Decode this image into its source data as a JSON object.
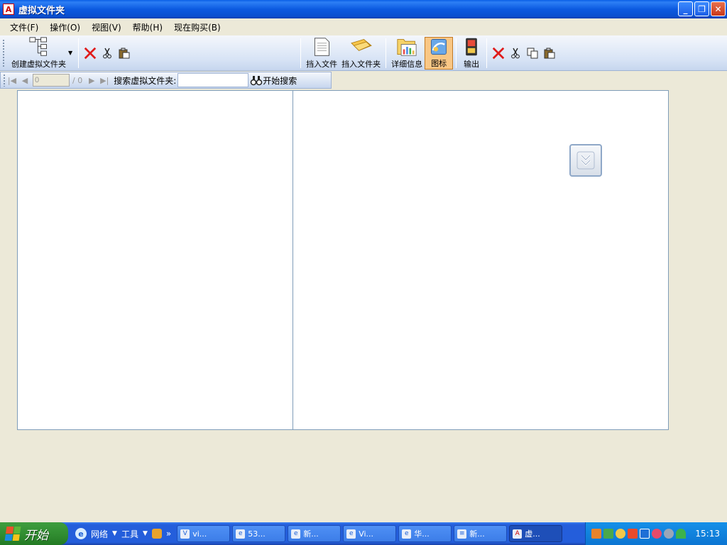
{
  "window": {
    "title": "虚拟文件夹",
    "app_icon": "A",
    "controls": {
      "minimize": "_",
      "restore": "❐",
      "close": "✕"
    }
  },
  "menu": {
    "items": [
      {
        "label": "文件(F)"
      },
      {
        "label": "操作(O)"
      },
      {
        "label": "视图(V)"
      },
      {
        "label": "帮助(H)"
      },
      {
        "label": "现在购买(B)"
      }
    ]
  },
  "toolbar": {
    "create_folder_label": "创建虚拟文件夹",
    "insert_file_label": "挡入文件",
    "insert_folder_label": "挡入文件夹",
    "details_label": "详细信息",
    "icons_label": "图标",
    "export_label": "输出",
    "active_view": "图标"
  },
  "search": {
    "page_value": "0",
    "page_total": "/ 0",
    "label": "搜索虚拟文件夹:",
    "query": "",
    "button_label": "开始搜索"
  },
  "taskbar": {
    "start_label": "开始",
    "quicklaunch": {
      "network_label": "网络",
      "tools_label": "工具",
      "more": "»"
    },
    "tasks": [
      {
        "label": "vi...",
        "icon": "V"
      },
      {
        "label": "53...",
        "icon": "e"
      },
      {
        "label": "新...",
        "icon": "e"
      },
      {
        "label": "Vi...",
        "icon": "e"
      },
      {
        "label": "华...",
        "icon": "e"
      },
      {
        "label": "新...",
        "icon": "≡"
      },
      {
        "label": "虚...",
        "icon": "A"
      }
    ],
    "active_task_index": 6,
    "clock": "15:13"
  },
  "colors": {
    "title_bar": "#0A5FE6",
    "chrome": "#ECE9D8",
    "taskbar": "#245EDB",
    "start": "#2F8A2F",
    "delete_red": "#E01B1B"
  }
}
